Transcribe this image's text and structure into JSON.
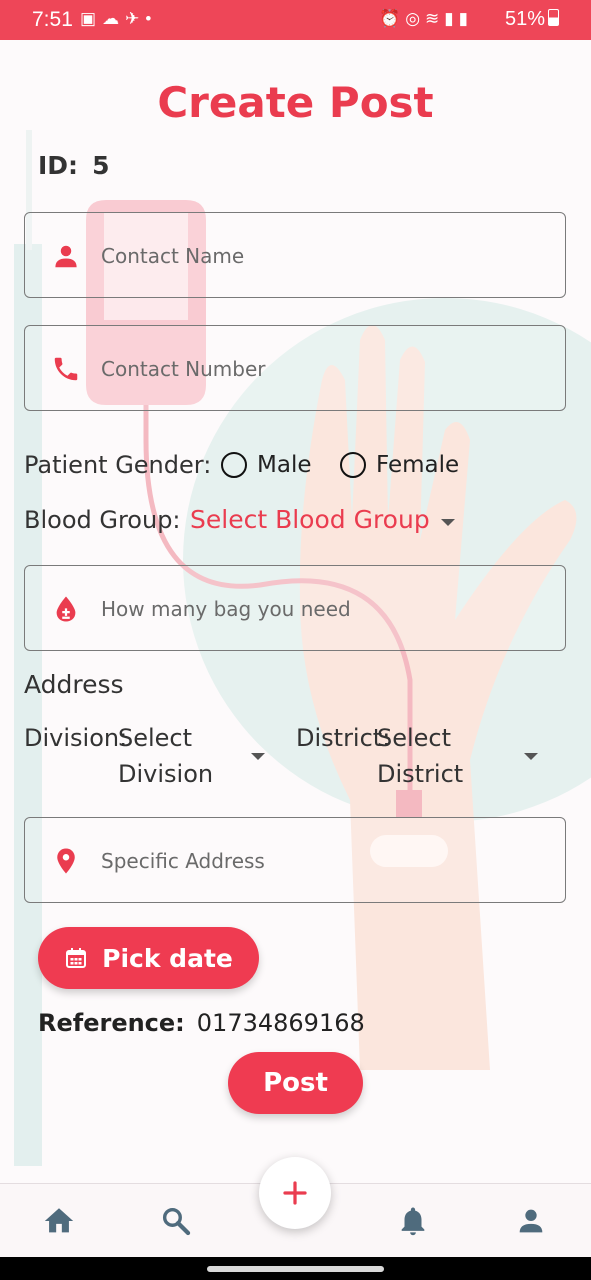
{
  "status_bar": {
    "time": "7:51",
    "battery": "51%",
    "left_icons": [
      "gallery-icon",
      "weather-icon",
      "plane-icon",
      "dot-icon"
    ],
    "right_icons": [
      "alarm-icon",
      "hotspot-icon",
      "wifi-icon",
      "signal-icon",
      "signal-icon"
    ]
  },
  "page": {
    "title": "Create Post",
    "id_label": "ID:",
    "id_value": "5"
  },
  "form": {
    "contact_name_placeholder": "Contact Name",
    "contact_number_placeholder": "Contact Number",
    "gender_label": "Patient Gender:",
    "gender_options": [
      "Male",
      "Female"
    ],
    "blood_group_label": "Blood Group:",
    "blood_group_value": "Select Blood Group",
    "bags_placeholder": "How many bag you need",
    "address_title": "Address",
    "division_label": "Division:",
    "division_value_line1": "Select",
    "division_value_line2": "Division",
    "district_label": "District:",
    "district_value_line1": "Select",
    "district_value_line2": "District",
    "specific_address_placeholder": "Specific Address",
    "pick_date_label": "Pick date",
    "reference_label": "Reference:",
    "reference_value": "01734869168",
    "post_label": "Post"
  },
  "bottom_nav": {
    "items": [
      "home-icon",
      "search-icon",
      "add-icon",
      "notifications-icon",
      "profile-icon"
    ]
  },
  "colors": {
    "accent": "#ea3c4f",
    "status_bar": "#ee4658",
    "nav_icon": "#4f6b7d"
  }
}
